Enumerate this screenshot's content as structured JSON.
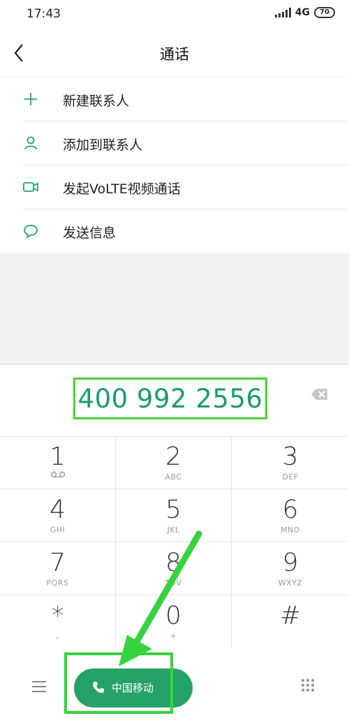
{
  "status": {
    "time": "17:43",
    "network": "4G",
    "battery": "70"
  },
  "header": {
    "title": "通话"
  },
  "actions": [
    {
      "label": "新建联系人",
      "icon": "plus-icon"
    },
    {
      "label": "添加到联系人",
      "icon": "person-icon"
    },
    {
      "label": "发起VoLTE视频通话",
      "icon": "video-icon"
    },
    {
      "label": "发送信息",
      "icon": "message-icon"
    }
  ],
  "dialer": {
    "number": "400 992 2556"
  },
  "keys": [
    {
      "digit": "1",
      "letters": ""
    },
    {
      "digit": "2",
      "letters": "ABC"
    },
    {
      "digit": "3",
      "letters": "DEF"
    },
    {
      "digit": "4",
      "letters": "GHI"
    },
    {
      "digit": "5",
      "letters": "JKL"
    },
    {
      "digit": "6",
      "letters": "MNO"
    },
    {
      "digit": "7",
      "letters": "PQRS"
    },
    {
      "digit": "8",
      "letters": "TUV"
    },
    {
      "digit": "9",
      "letters": "WXYZ"
    },
    {
      "digit": "*",
      "letters": ","
    },
    {
      "digit": "0",
      "letters": "+"
    },
    {
      "digit": "#",
      "letters": ""
    }
  ],
  "call": {
    "carrier": "中国移动"
  },
  "colors": {
    "accent": "#25a366",
    "highlight": "#35d33d",
    "number": "#1e9a6c"
  }
}
